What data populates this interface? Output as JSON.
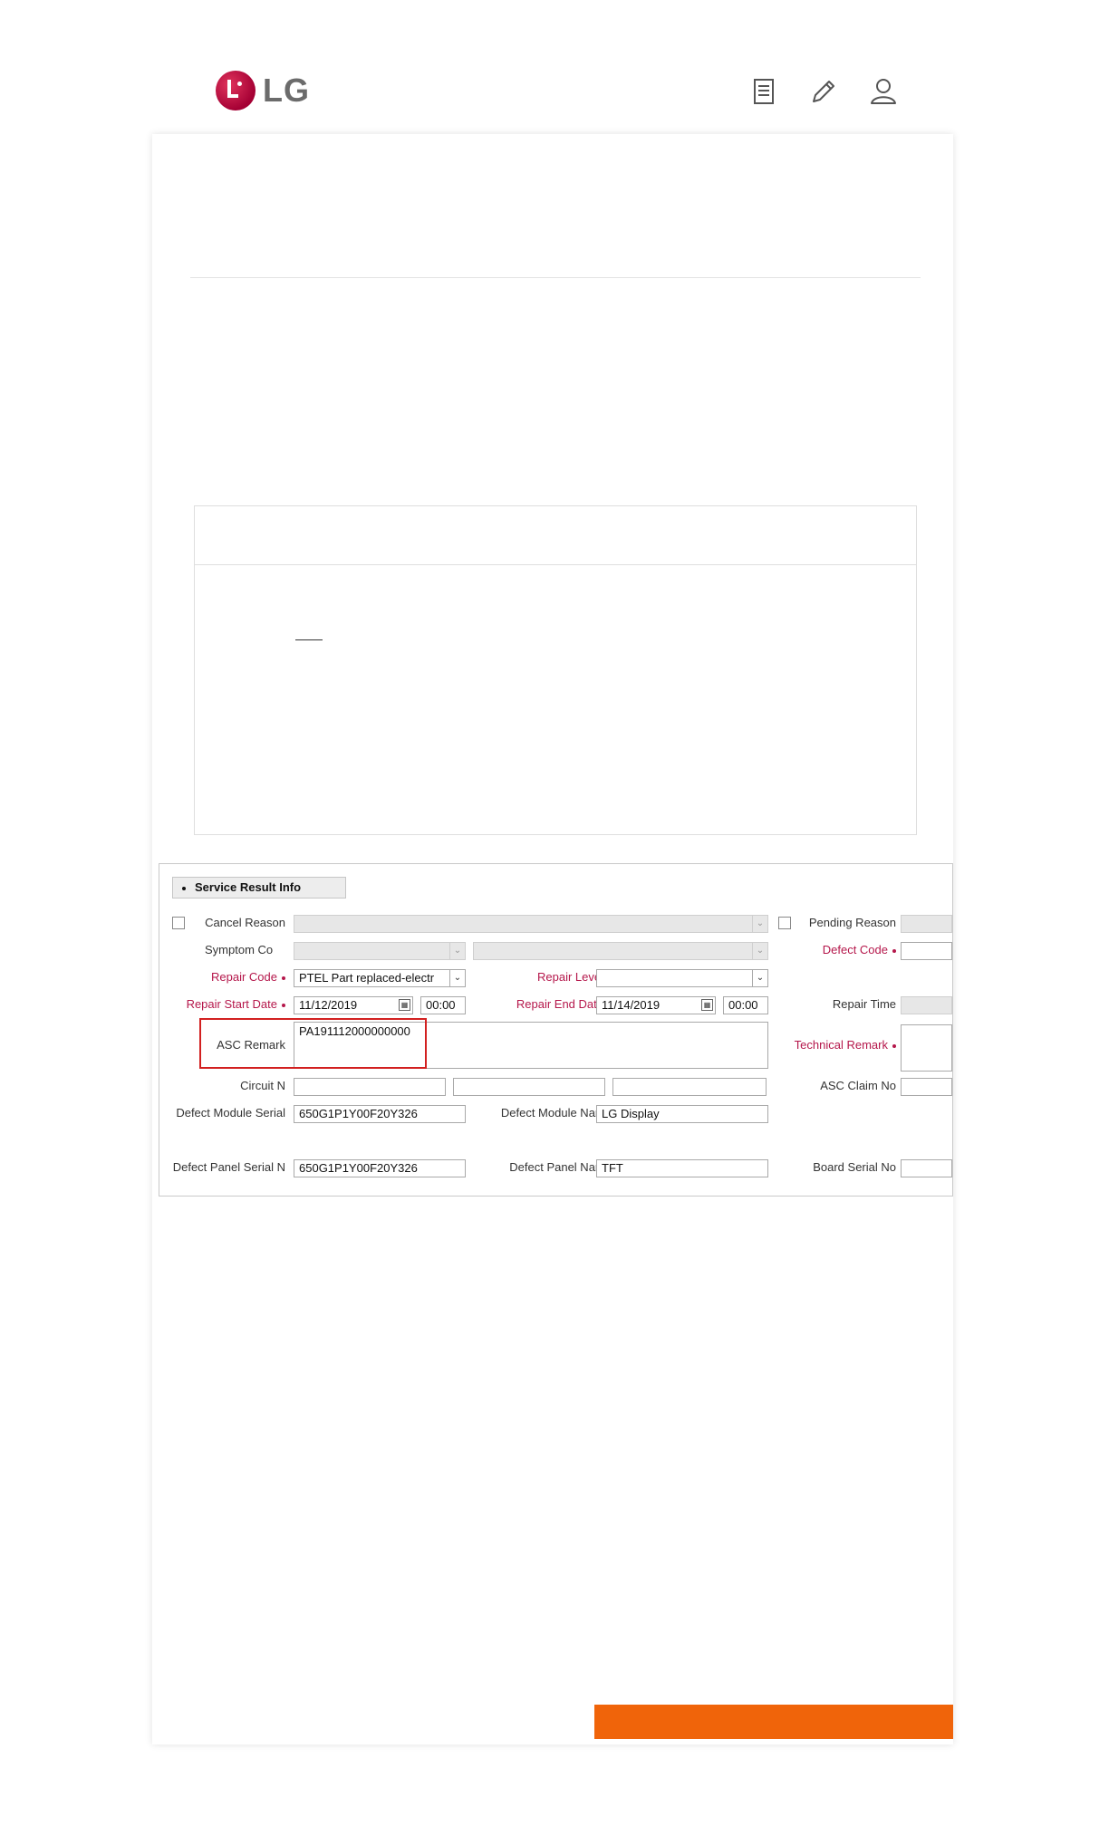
{
  "brand": {
    "logo_text": "LG",
    "accent": "#a50034"
  },
  "header_icons": [
    "document-icon",
    "pencil-icon",
    "user-icon"
  ],
  "form": {
    "section_title": "Service Result Info",
    "cancel_reason_label": "Cancel Reason",
    "pending_reason_label": "Pending Reason",
    "symptom_label": "Symptom Co",
    "defect_code_label": "Defect Code",
    "repair_code_label": "Repair Code",
    "repair_code_value": "PTEL  Part replaced-electr",
    "repair_level_label": "Repair Level",
    "repair_level_value": "",
    "repair_start_label": "Repair Start Date",
    "repair_start_date": "11/12/2019",
    "repair_start_time": "00:00",
    "repair_end_label": "Repair End Date",
    "repair_end_date": "11/14/2019",
    "repair_end_time": "00:00",
    "repair_time_label": "Repair Time",
    "asc_remark_label": "ASC Remark",
    "asc_remark_value": "PA191112000000000",
    "technical_remark_label": "Technical Remark",
    "circuit_label": "Circuit N",
    "asc_claim_label": "ASC Claim No",
    "defect_module_serial_label": "Defect Module Serial",
    "defect_module_serial_value": "650G1P1Y00F20Y326",
    "defect_module_name_label": "Defect Module Name",
    "defect_module_name_value": "LG Display",
    "defect_panel_serial_label": "Defect Panel Serial N",
    "defect_panel_serial_value": "650G1P1Y00F20Y326",
    "defect_panel_name_label": "Defect Panel Name",
    "defect_panel_name_value": "TFT",
    "board_serial_label": "Board Serial No"
  },
  "colors": {
    "required_label": "#b5174b",
    "highlight": "#d22020",
    "orange_button": "#f0640a"
  }
}
